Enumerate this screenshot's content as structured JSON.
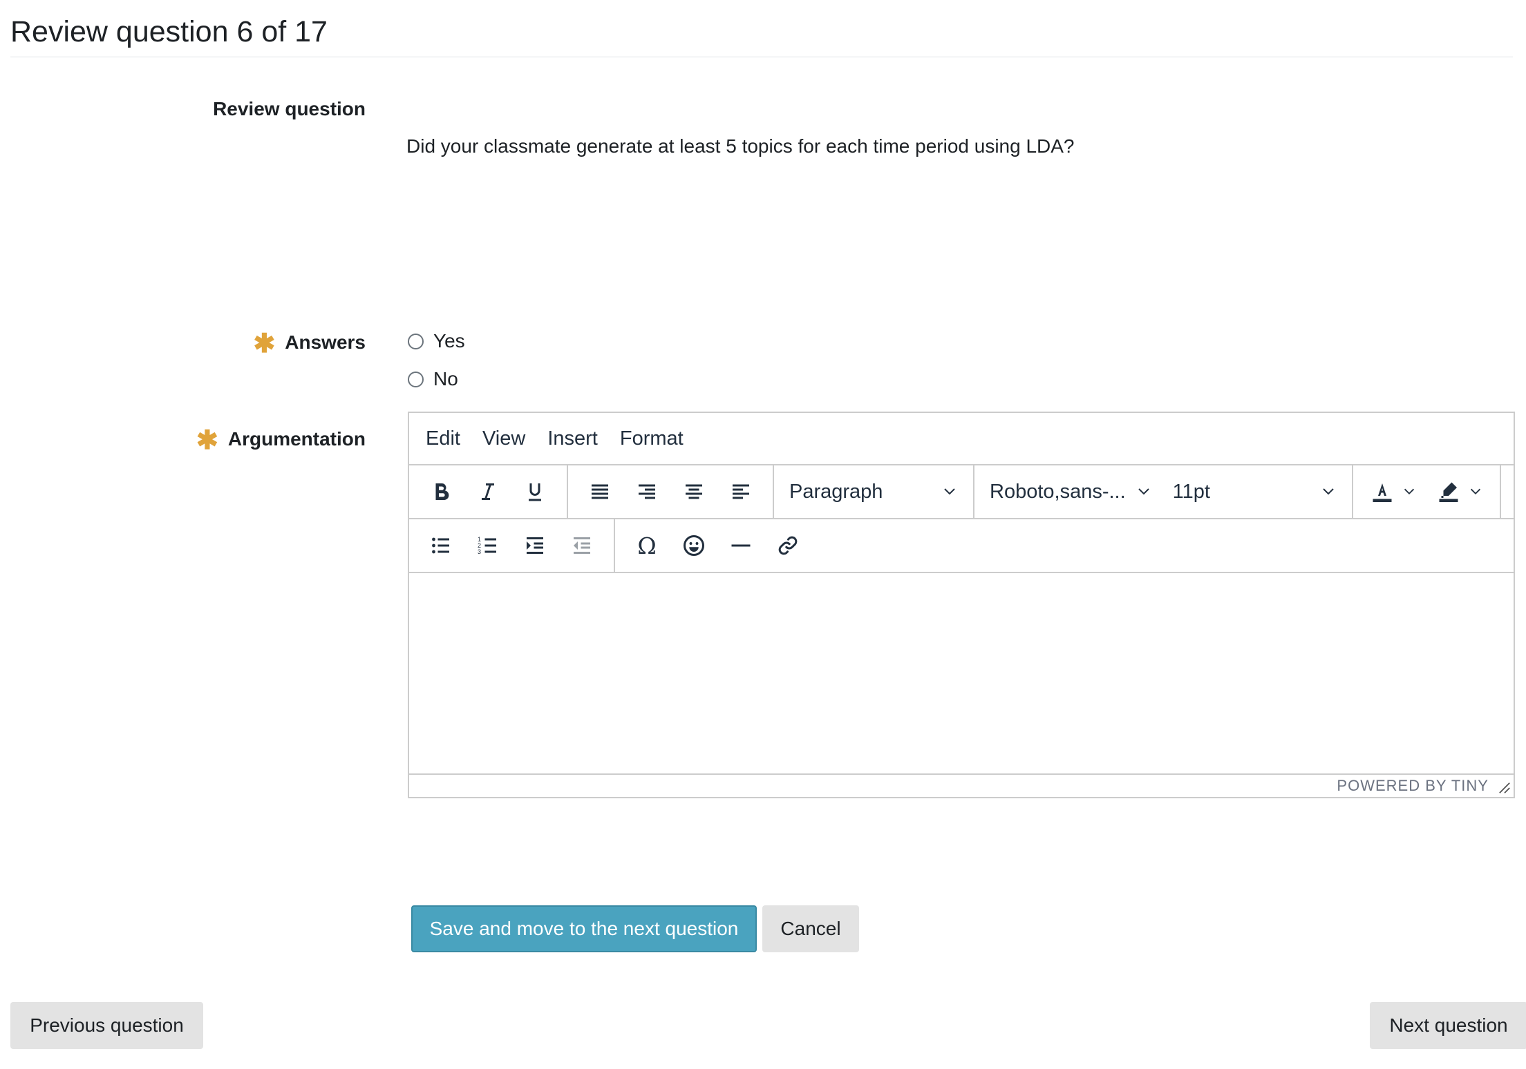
{
  "header": {
    "title": "Review question 6 of 17"
  },
  "review": {
    "label": "Review question",
    "text": "Did your classmate generate at least 5 topics for each time period using LDA?"
  },
  "answers": {
    "label": "Answers",
    "required_mark": "✱",
    "options": [
      {
        "label": "Yes",
        "checked": false
      },
      {
        "label": "No",
        "checked": false
      }
    ]
  },
  "argumentation": {
    "label": "Argumentation",
    "required_mark": "✱",
    "editor": {
      "menu": [
        "Edit",
        "View",
        "Insert",
        "Format"
      ],
      "block_format": "Paragraph",
      "font_family": "Roboto,sans-...",
      "font_size": "11pt",
      "branding": "POWERED BY TINY",
      "icons_row1": [
        "bold-icon",
        "italic-icon",
        "underline-icon",
        "align-justify-icon",
        "align-right-icon",
        "align-center-icon",
        "align-left-icon",
        "text-color-icon",
        "highlight-color-icon"
      ],
      "icons_row2": [
        "bullet-list-icon",
        "numbered-list-icon",
        "indent-icon",
        "outdent-icon",
        "special-character-icon",
        "emoji-icon",
        "horizontal-rule-icon",
        "link-icon"
      ]
    }
  },
  "actions": {
    "save_label": "Save and move to the next question",
    "cancel_label": "Cancel",
    "previous_label": "Previous question",
    "next_label": "Next question"
  },
  "colors": {
    "primary": "#4aa3bf",
    "required": "#e0a33a",
    "secondary_button": "#e3e3e3"
  }
}
